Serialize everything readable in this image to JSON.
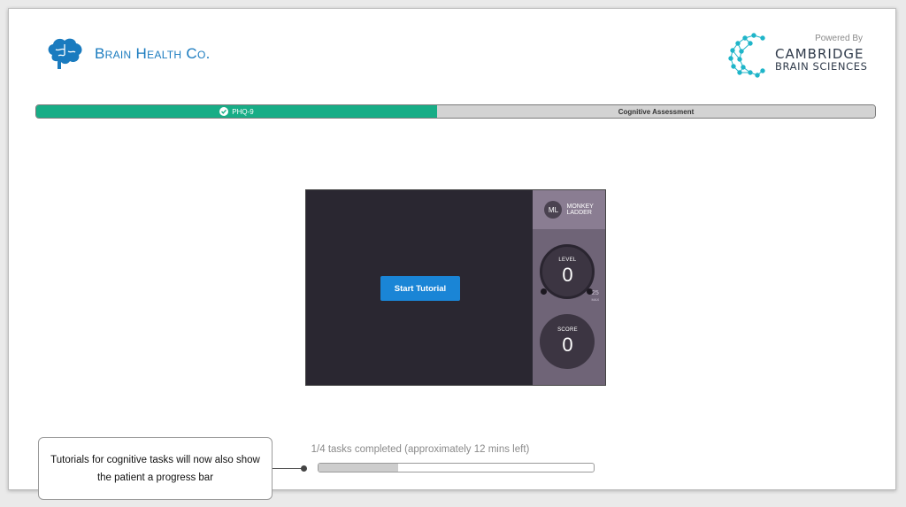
{
  "header": {
    "brand_name": "Brain Health Co.",
    "powered_by": "Powered By",
    "partner_line1": "CAMBRIDGE",
    "partner_line2": "BRAIN SCIENCES"
  },
  "steps": [
    {
      "label": "PHQ-9",
      "status": "completed",
      "color": "#17ad86"
    },
    {
      "label": "Cognitive Assessment",
      "status": "current",
      "color": "#d3d3d3"
    }
  ],
  "game": {
    "start_label": "Start Tutorial",
    "task_badge": "ML",
    "task_name": "MONKEY LADDER",
    "level_label": "LEVEL",
    "level_value": "0",
    "max_value": "25",
    "max_label": "MAX",
    "score_label": "SCORE",
    "score_value": "0",
    "accent_color": "#1a85d6"
  },
  "progress": {
    "text": "1/4 tasks completed (approximately 12 mins left)",
    "fraction": 0.25
  },
  "callout": {
    "text": "Tutorials for cognitive tasks will now also show the patient a progress bar"
  },
  "icons": {
    "brand": "brain-icon",
    "partner": "cambridge-dots-icon",
    "step_check": "check-circle-icon"
  }
}
